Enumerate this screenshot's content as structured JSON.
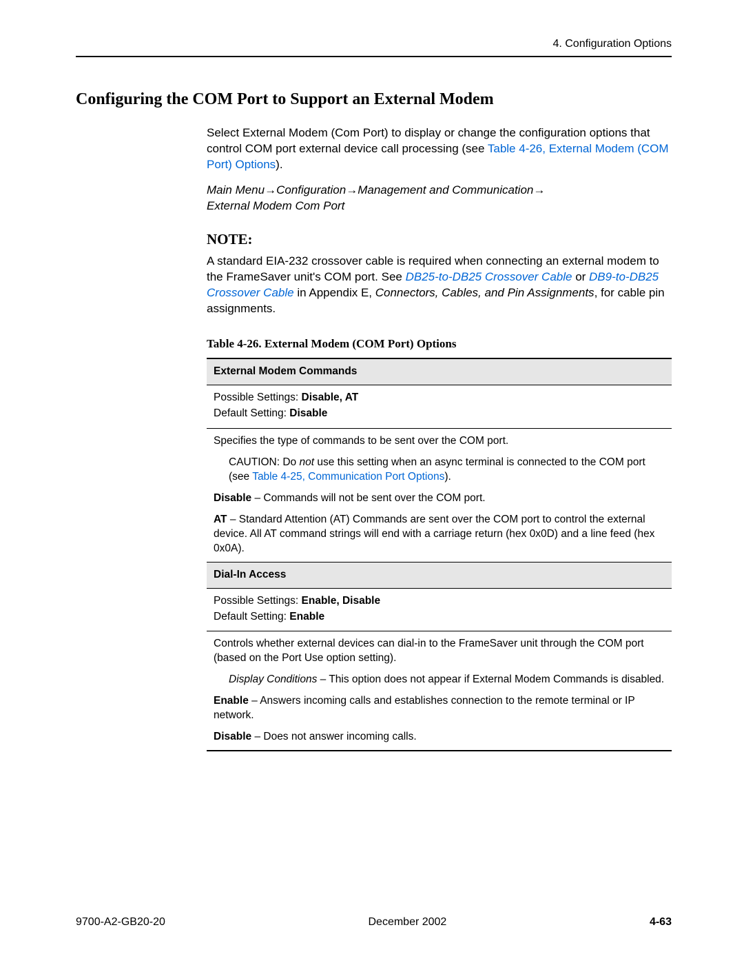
{
  "header": {
    "chapter": "4. Configuration Options"
  },
  "section_title": "Configuring the COM Port to Support an External Modem",
  "intro": {
    "text_before_link": "Select External Modem (Com Port) to display or change the configuration options that control COM port external device call processing (see ",
    "link": "Table 4-26, External Modem (COM Port) Options",
    "text_after_link": ")."
  },
  "menu_path": {
    "line1": "Main Menu→Configuration→Management and Communication→",
    "line2": "External Modem Com Port"
  },
  "note": {
    "heading": "NOTE:",
    "text1": "A standard EIA-232 crossover cable is required when connecting an external modem to the FrameSaver unit's COM port. See ",
    "link1": "DB25-to-DB25 Crossover Cable",
    "mid": " or ",
    "link2": "DB9-to-DB25 Crossover Cable",
    "text2_a": " in Appendix E, ",
    "text2_b": "Connectors, Cables, and Pin Assignments",
    "text2_c": ", for cable pin assignments."
  },
  "table": {
    "caption": "Table 4-26.  External Modem (COM Port) Options",
    "row1": {
      "header": "External Modem Commands",
      "settings_label": "Possible Settings: ",
      "settings_value": "Disable, AT",
      "default_label": "Default Setting: ",
      "default_value": "Disable",
      "desc": "Specifies the type of commands to be sent over the COM port.",
      "caution_prefix": "CAUTION: Do ",
      "caution_not": "not",
      "caution_mid": " use this setting when an async terminal is connected to the COM port (see ",
      "caution_link": "Table 4-25, Communication Port Options",
      "caution_end": ").",
      "disable_label": "Disable",
      "disable_text": " – Commands will not be sent over the COM port.",
      "at_label": "AT",
      "at_text": " – Standard Attention (AT) Commands are sent over the COM port to control the external device. All AT command strings will end with a carriage return (hex 0x0D) and a line feed (hex 0x0A)."
    },
    "row2": {
      "header": "Dial-In Access",
      "settings_label": "Possible Settings: ",
      "settings_value": "Enable, Disable",
      "default_label": "Default Setting: ",
      "default_value": "Enable",
      "desc": "Controls whether external devices can dial-in to the FrameSaver unit through the COM port (based on the Port Use option setting).",
      "display_label": "Display Conditions",
      "display_text": " – This option does not appear if External Modem Commands is disabled.",
      "enable_label": "Enable",
      "enable_text": " – Answers incoming calls and establishes connection to the remote terminal or IP network.",
      "disable_label": "Disable",
      "disable_text": " – Does not answer incoming calls."
    }
  },
  "footer": {
    "docnum": "9700-A2-GB20-20",
    "date": "December 2002",
    "pagenum": "4-63"
  }
}
